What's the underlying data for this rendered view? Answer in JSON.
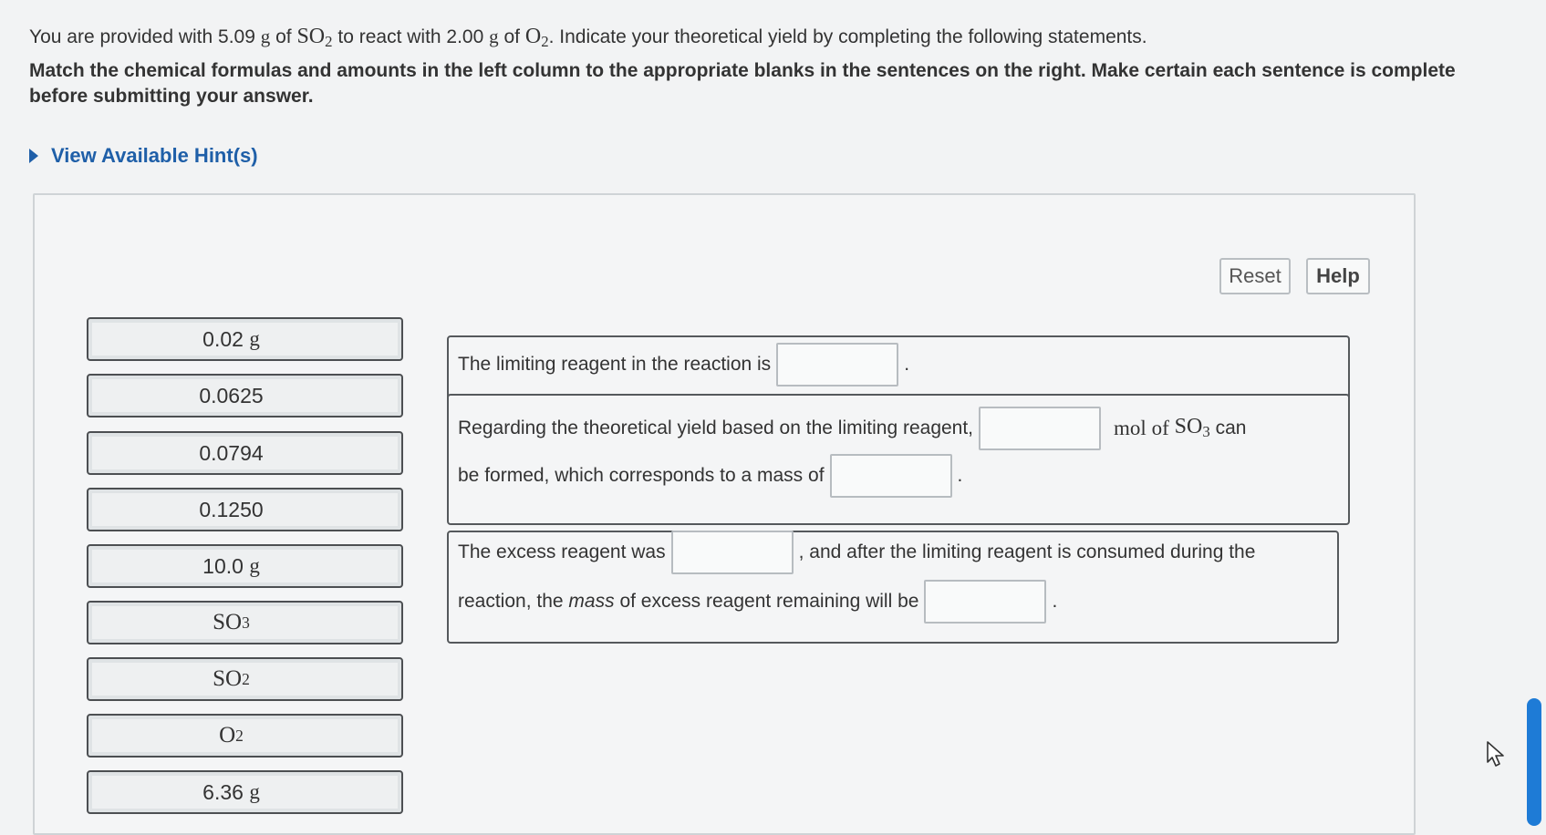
{
  "question": {
    "line1_a": "You are provided with 5.09",
    "line1_g1": "g",
    "line1_b": "of",
    "line1_so2": "SO",
    "line1_so2_sub": "2",
    "line1_c": "to react with 2.00",
    "line1_g2": "g",
    "line1_d": "of",
    "line1_o2": "O",
    "line1_o2_sub": "2",
    "line1_e": ". Indicate your theoretical yield by completing the following statements.",
    "line2": "Match the chemical formulas and amounts in the left column to the appropriate blanks in the sentences on the right. Make certain each sentence is complete before submitting your answer."
  },
  "hint": {
    "label": "View Available Hint(s)"
  },
  "buttons": {
    "reset": "Reset",
    "help": "Help"
  },
  "tiles": [
    {
      "main": "0.02",
      "unit": "g"
    },
    {
      "main": "0.0625",
      "unit": ""
    },
    {
      "main": "0.0794",
      "unit": ""
    },
    {
      "main": "0.1250",
      "unit": ""
    },
    {
      "main": "10.0",
      "unit": "g"
    },
    {
      "main": "SO",
      "sub": "3"
    },
    {
      "main": "SO",
      "sub": "2"
    },
    {
      "main": "O",
      "sub": "2"
    },
    {
      "main": "6.36",
      "unit": "g"
    }
  ],
  "sentences": {
    "s1": {
      "a": "The limiting reagent in the reaction is",
      "end": "."
    },
    "s2": {
      "a": "Regarding the theoretical yield based on the limiting reagent,",
      "b_mol": "mol",
      "b_of": "of",
      "b_so3": "SO",
      "b_so3_sub": "3",
      "b_can": "can",
      "c": "be formed, which corresponds to a mass of",
      "end": "."
    },
    "s3": {
      "a": "The excess reagent was",
      "b": ", and after the limiting reagent is consumed during the",
      "c1": "reaction, the",
      "c_mass": "mass",
      "c2": "of excess reagent remaining will be",
      "end": "."
    }
  }
}
